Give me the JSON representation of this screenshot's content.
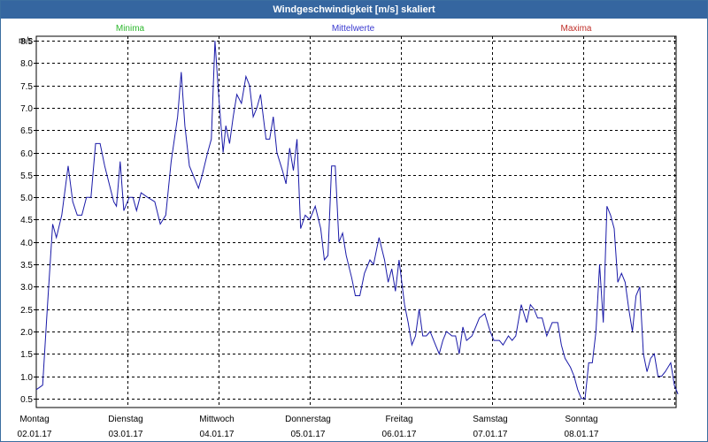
{
  "window": {
    "title": "Windgeschwindigkeit [m/s] skaliert"
  },
  "colors": {
    "titlebar": "#3566a0",
    "series_line": "#1a1aa8",
    "minima": "#2eb82e",
    "mittelwerte": "#3a3ad0",
    "maxima": "#c0302a",
    "grid": "#000000"
  },
  "chart_data": {
    "type": "line",
    "title": "Windgeschwindigkeit [m/s] skaliert",
    "ylabel": "m/s",
    "ylim": [
      0.3,
      8.6
    ],
    "yticks": [
      "0.5",
      "1.0",
      "1.5",
      "2.0",
      "2.5",
      "3.0",
      "3.5",
      "4.0",
      "4.5",
      "5.0",
      "5.5",
      "6.0",
      "6.5",
      "7.0",
      "7.5",
      "8.0",
      "8.5"
    ],
    "grid": true,
    "legend": [
      {
        "label": "Minima",
        "color": "#2eb82e"
      },
      {
        "label": "Mittelwerte",
        "color": "#3a3ad0"
      },
      {
        "label": "Maxima",
        "color": "#c0302a"
      }
    ],
    "xlim": [
      0,
      7.06
    ],
    "days": [
      {
        "day": "Montag",
        "date": "02.01.17"
      },
      {
        "day": "Dienstag",
        "date": "03.01.17"
      },
      {
        "day": "Mittwoch",
        "date": "04.01.17"
      },
      {
        "day": "Donnerstag",
        "date": "05.01.17"
      },
      {
        "day": "Freitag",
        "date": "06.01.17"
      },
      {
        "day": "Samstag",
        "date": "07.01.17"
      },
      {
        "day": "Sonntag",
        "date": "08.01.17"
      }
    ],
    "series": [
      {
        "color": "#1a1aa8",
        "points": [
          [
            0.0,
            0.7
          ],
          [
            0.07,
            0.8
          ],
          [
            0.12,
            2.5
          ],
          [
            0.18,
            4.4
          ],
          [
            0.22,
            4.1
          ],
          [
            0.28,
            4.6
          ],
          [
            0.35,
            5.7
          ],
          [
            0.4,
            4.9
          ],
          [
            0.45,
            4.6
          ],
          [
            0.5,
            4.6
          ],
          [
            0.55,
            5.0
          ],
          [
            0.6,
            5.0
          ],
          [
            0.65,
            6.2
          ],
          [
            0.7,
            6.2
          ],
          [
            0.75,
            5.7
          ],
          [
            0.8,
            5.3
          ],
          [
            0.85,
            4.9
          ],
          [
            0.88,
            4.8
          ],
          [
            0.92,
            5.8
          ],
          [
            0.96,
            4.7
          ],
          [
            1.02,
            5.0
          ],
          [
            1.06,
            5.0
          ],
          [
            1.1,
            4.7
          ],
          [
            1.15,
            5.1
          ],
          [
            1.22,
            5.0
          ],
          [
            1.3,
            4.9
          ],
          [
            1.36,
            4.4
          ],
          [
            1.42,
            4.6
          ],
          [
            1.48,
            5.8
          ],
          [
            1.55,
            6.8
          ],
          [
            1.59,
            7.8
          ],
          [
            1.63,
            6.6
          ],
          [
            1.68,
            5.7
          ],
          [
            1.72,
            5.5
          ],
          [
            1.78,
            5.2
          ],
          [
            1.82,
            5.5
          ],
          [
            1.88,
            6.0
          ],
          [
            1.92,
            6.3
          ],
          [
            1.96,
            8.5
          ],
          [
            2.0,
            7.3
          ],
          [
            2.05,
            6.0
          ],
          [
            2.08,
            6.6
          ],
          [
            2.12,
            6.2
          ],
          [
            2.16,
            6.8
          ],
          [
            2.2,
            7.3
          ],
          [
            2.25,
            7.1
          ],
          [
            2.3,
            7.7
          ],
          [
            2.34,
            7.5
          ],
          [
            2.38,
            6.8
          ],
          [
            2.42,
            7.0
          ],
          [
            2.46,
            7.3
          ],
          [
            2.52,
            6.3
          ],
          [
            2.56,
            6.3
          ],
          [
            2.6,
            6.8
          ],
          [
            2.64,
            6.0
          ],
          [
            2.7,
            5.6
          ],
          [
            2.74,
            5.3
          ],
          [
            2.78,
            6.1
          ],
          [
            2.82,
            5.6
          ],
          [
            2.86,
            6.3
          ],
          [
            2.9,
            4.3
          ],
          [
            2.95,
            4.6
          ],
          [
            3.0,
            4.5
          ],
          [
            3.06,
            4.8
          ],
          [
            3.12,
            4.3
          ],
          [
            3.16,
            3.6
          ],
          [
            3.2,
            3.7
          ],
          [
            3.24,
            5.7
          ],
          [
            3.28,
            5.7
          ],
          [
            3.32,
            4.0
          ],
          [
            3.36,
            4.2
          ],
          [
            3.4,
            3.7
          ],
          [
            3.46,
            3.2
          ],
          [
            3.5,
            2.8
          ],
          [
            3.55,
            2.8
          ],
          [
            3.6,
            3.3
          ],
          [
            3.66,
            3.6
          ],
          [
            3.7,
            3.5
          ],
          [
            3.76,
            4.1
          ],
          [
            3.82,
            3.6
          ],
          [
            3.86,
            3.1
          ],
          [
            3.9,
            3.4
          ],
          [
            3.94,
            2.9
          ],
          [
            3.98,
            3.6
          ],
          [
            4.04,
            2.6
          ],
          [
            4.08,
            2.2
          ],
          [
            4.12,
            1.7
          ],
          [
            4.16,
            1.9
          ],
          [
            4.2,
            2.5
          ],
          [
            4.24,
            1.9
          ],
          [
            4.28,
            1.9
          ],
          [
            4.32,
            2.0
          ],
          [
            4.38,
            1.7
          ],
          [
            4.42,
            1.5
          ],
          [
            4.46,
            1.8
          ],
          [
            4.5,
            2.0
          ],
          [
            4.56,
            1.9
          ],
          [
            4.6,
            1.9
          ],
          [
            4.64,
            1.5
          ],
          [
            4.68,
            2.1
          ],
          [
            4.72,
            1.8
          ],
          [
            4.78,
            1.9
          ],
          [
            4.82,
            2.1
          ],
          [
            4.86,
            2.3
          ],
          [
            4.92,
            2.4
          ],
          [
            4.98,
            2.0
          ],
          [
            5.02,
            1.8
          ],
          [
            5.08,
            1.8
          ],
          [
            5.12,
            1.7
          ],
          [
            5.18,
            1.9
          ],
          [
            5.22,
            1.8
          ],
          [
            5.26,
            1.9
          ],
          [
            5.32,
            2.6
          ],
          [
            5.38,
            2.2
          ],
          [
            5.42,
            2.6
          ],
          [
            5.46,
            2.5
          ],
          [
            5.5,
            2.3
          ],
          [
            5.55,
            2.3
          ],
          [
            5.6,
            1.9
          ],
          [
            5.66,
            2.2
          ],
          [
            5.72,
            2.2
          ],
          [
            5.76,
            1.7
          ],
          [
            5.8,
            1.4
          ],
          [
            5.86,
            1.2
          ],
          [
            5.9,
            1.0
          ],
          [
            5.94,
            0.7
          ],
          [
            5.98,
            0.5
          ],
          [
            6.02,
            0.5
          ],
          [
            6.06,
            1.3
          ],
          [
            6.1,
            1.3
          ],
          [
            6.14,
            2.0
          ],
          [
            6.18,
            3.5
          ],
          [
            6.22,
            2.2
          ],
          [
            6.26,
            4.8
          ],
          [
            6.3,
            4.6
          ],
          [
            6.34,
            4.3
          ],
          [
            6.38,
            3.1
          ],
          [
            6.42,
            3.3
          ],
          [
            6.46,
            3.1
          ],
          [
            6.5,
            2.5
          ],
          [
            6.54,
            2.0
          ],
          [
            6.58,
            2.8
          ],
          [
            6.62,
            3.0
          ],
          [
            6.66,
            1.5
          ],
          [
            6.7,
            1.1
          ],
          [
            6.74,
            1.4
          ],
          [
            6.78,
            1.5
          ],
          [
            6.82,
            1.0
          ],
          [
            6.86,
            1.0
          ],
          [
            6.9,
            1.1
          ],
          [
            6.96,
            1.3
          ],
          [
            7.0,
            0.8
          ],
          [
            7.04,
            0.6
          ]
        ]
      }
    ]
  }
}
